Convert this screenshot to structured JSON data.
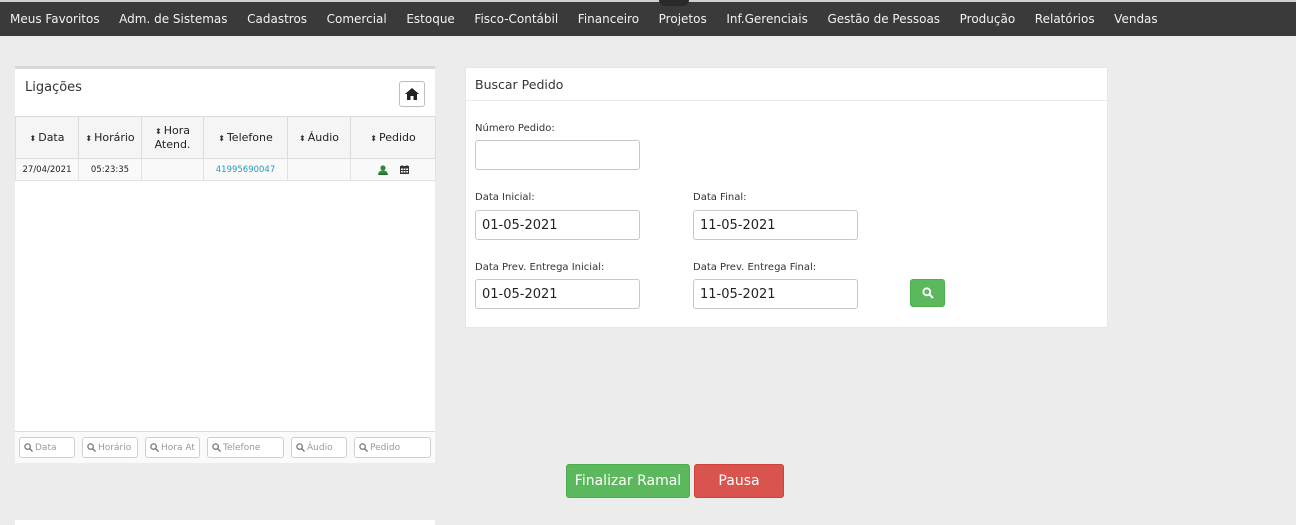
{
  "nav": {
    "items": [
      "Meus Favoritos",
      "Adm. de Sistemas",
      "Cadastros",
      "Comercial",
      "Estoque",
      "Fisco-Contábil",
      "Financeiro",
      "Projetos",
      "Inf.Gerenciais",
      "Gestão de Pessoas",
      "Produção",
      "Relatórios",
      "Vendas"
    ]
  },
  "calls": {
    "title": "Ligações",
    "columns": [
      {
        "label": "Data"
      },
      {
        "label": "Horário"
      },
      {
        "label": "Hora Atend."
      },
      {
        "label": "Telefone"
      },
      {
        "label": "Áudio"
      },
      {
        "label": "Pedido"
      }
    ],
    "rows": [
      {
        "data": "27/04/2021",
        "horario": "05:23:35",
        "hora_atend": "",
        "telefone": "41995690047",
        "audio": ""
      }
    ],
    "filters": [
      "Data",
      "Horário",
      "Hora At",
      "Telefone",
      "Áudio",
      "Pedido"
    ]
  },
  "search": {
    "title": "Buscar Pedido",
    "numero_label": "Número Pedido:",
    "numero_value": "",
    "data_inicial_label": "Data Inicial:",
    "data_inicial_value": "01-05-2021",
    "data_final_label": "Data Final:",
    "data_final_value": "11-05-2021",
    "prev_inicial_label": "Data Prev. Entrega Inicial:",
    "prev_inicial_value": "01-05-2021",
    "prev_final_label": "Data Prev. Entrega Final:",
    "prev_final_value": "11-05-2021"
  },
  "actions": {
    "finalizar_label": "Finalizar Ramal",
    "pausa_label": "Pausa"
  },
  "colors": {
    "nav_bg": "#3a3a3a",
    "success": "#5cb85c",
    "danger": "#d9534f",
    "link": "#2a9ab8"
  }
}
